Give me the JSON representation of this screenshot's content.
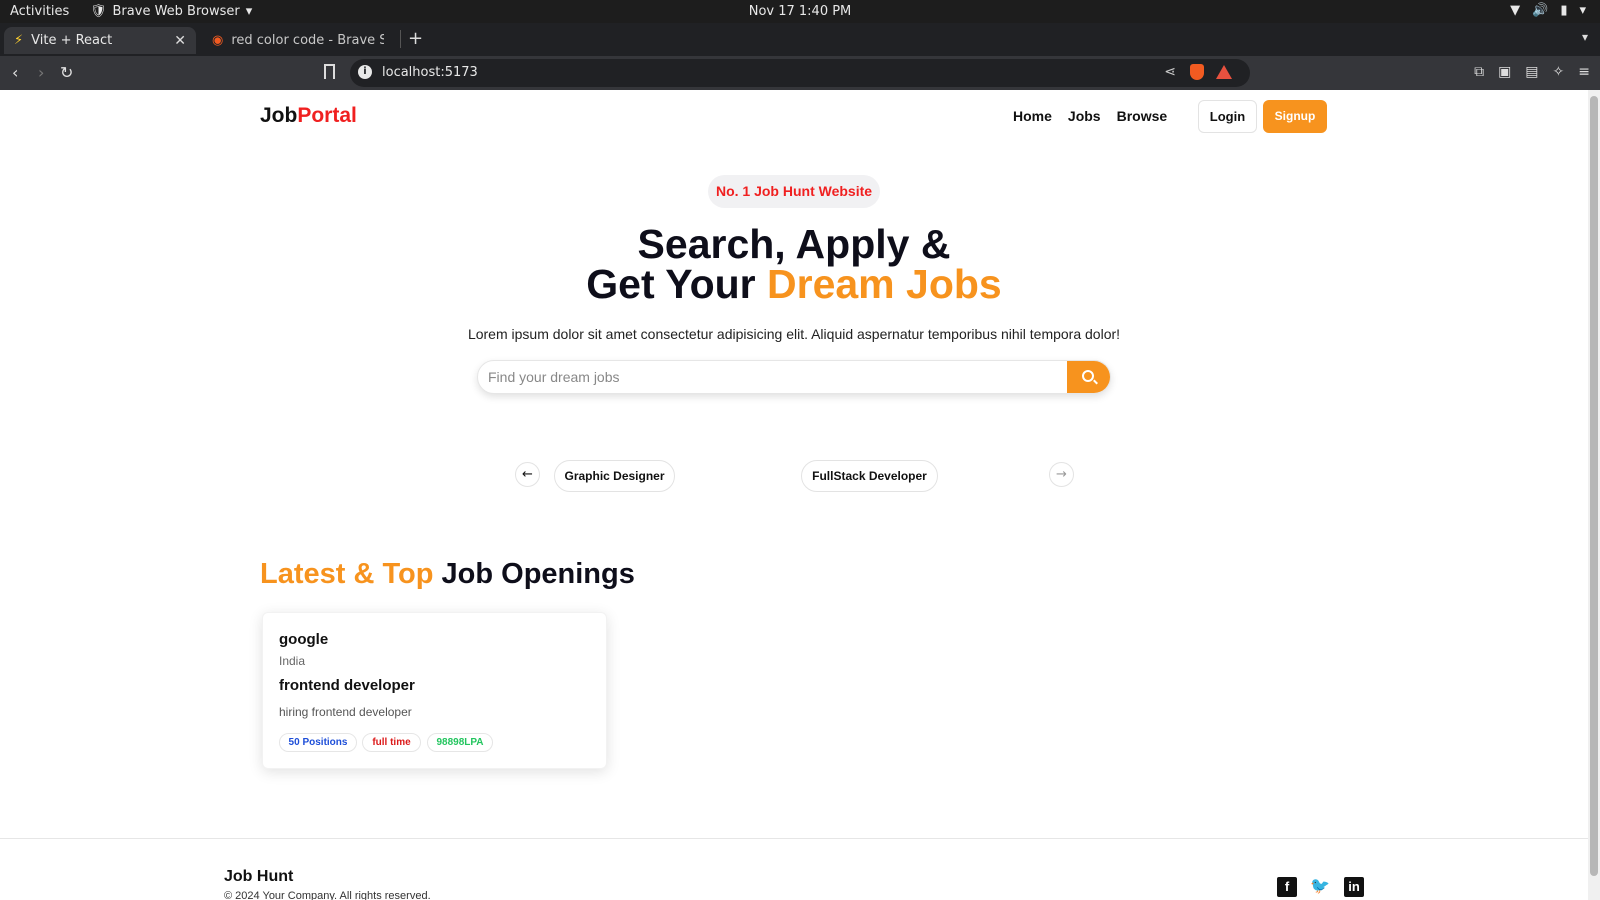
{
  "os": {
    "activities": "Activities",
    "app_name": "Brave Web Browser",
    "clock": "Nov 17  1:40 PM"
  },
  "browser": {
    "tabs": [
      {
        "title": "Vite + React",
        "active": true
      },
      {
        "title": "red color code - Brave Search",
        "active": false
      }
    ],
    "url": "localhost:5173"
  },
  "navbar": {
    "logo_main": "Job",
    "logo_accent": "Portal",
    "links": [
      "Home",
      "Jobs",
      "Browse"
    ],
    "login_label": "Login",
    "signup_label": "Signup"
  },
  "hero": {
    "badge": "No. 1 Job Hunt Website",
    "line1": "Search, Apply &",
    "line2_main": "Get Your ",
    "line2_accent": "Dream Jobs",
    "subtitle": "Lorem ipsum dolor sit amet consectetur adipisicing elit. Aliquid aspernatur temporibus nihil tempora dolor!",
    "search_placeholder": "Find your dream jobs"
  },
  "categories": {
    "items": [
      "Graphic Designer",
      "FullStack Developer"
    ]
  },
  "latest_jobs": {
    "title_accent": "Latest & Top",
    "title_main": " Job Openings",
    "jobs": [
      {
        "company": "google",
        "location": "India",
        "title": "frontend developer",
        "description": "hiring frontend developer",
        "positions": "50 Positions",
        "job_type": "full time",
        "salary": "98898LPA"
      }
    ]
  },
  "footer": {
    "title": "Job Hunt",
    "copyright": "© 2024 Your Company. All rights reserved."
  },
  "colors": {
    "accent_orange": "#f7931e",
    "accent_red": "#f02020"
  }
}
